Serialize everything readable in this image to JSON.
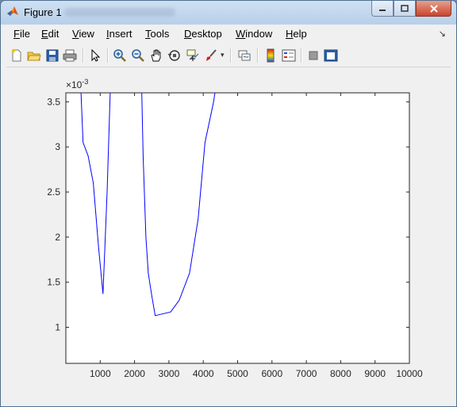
{
  "window": {
    "title": "Figure 1",
    "controls": {
      "minimize": "minimize-icon",
      "maximize": "maximize-icon",
      "close": "close-icon"
    }
  },
  "menubar": {
    "items": [
      {
        "label": "File",
        "mnemonic": "F",
        "rest": "ile"
      },
      {
        "label": "Edit",
        "mnemonic": "E",
        "rest": "dit"
      },
      {
        "label": "View",
        "mnemonic": "V",
        "rest": "iew"
      },
      {
        "label": "Insert",
        "mnemonic": "I",
        "rest": "nsert"
      },
      {
        "label": "Tools",
        "mnemonic": "T",
        "rest": "ools"
      },
      {
        "label": "Desktop",
        "mnemonic": "D",
        "rest": "esktop"
      },
      {
        "label": "Window",
        "mnemonic": "W",
        "rest": "indow"
      },
      {
        "label": "Help",
        "mnemonic": "H",
        "rest": "elp"
      }
    ]
  },
  "toolbar": {
    "buttons": [
      "new-figure-icon",
      "open-file-icon",
      "save-icon",
      "print-icon",
      "pointer-icon",
      "zoom-in-icon",
      "zoom-out-icon",
      "pan-icon",
      "rotate-3d-icon",
      "data-cursor-icon",
      "brush-icon",
      "link-plot-icon",
      "colorbar-icon",
      "legend-icon",
      "hide-plot-tools-icon",
      "show-plot-tools-icon"
    ]
  },
  "colors": {
    "line": "#0000ff",
    "axes_bg": "#ffffff",
    "figure_bg": "#f0f0f0"
  },
  "chart_data": {
    "type": "line",
    "exponent_label": "×10",
    "exponent_power": "-3",
    "xlim": [
      0,
      10000
    ],
    "ylim": [
      0.0006,
      0.0036
    ],
    "xticks": [
      1000,
      2000,
      3000,
      4000,
      5000,
      6000,
      7000,
      8000,
      9000,
      10000
    ],
    "xtick_labels": [
      "1000",
      "2000",
      "3000",
      "4000",
      "5000",
      "6000",
      "7000",
      "8000",
      "9000",
      "10000"
    ],
    "yticks": [
      0.001,
      0.0015,
      0.002,
      0.0025,
      0.003,
      0.0035
    ],
    "ytick_labels": [
      "1",
      "1.5",
      "2",
      "2.5",
      "3",
      "3.5"
    ],
    "segments": [
      {
        "x": [
          440,
          500,
          650,
          800,
          950,
          1080,
          1200,
          1290
        ],
        "y": [
          0.0036,
          0.00305,
          0.0029,
          0.0026,
          0.0019,
          0.00137,
          0.0025,
          0.0036
        ]
      },
      {
        "x": [
          2210,
          2250,
          2330,
          2400,
          2500,
          2600,
          3050,
          3300,
          3600,
          3850,
          4050,
          4300,
          4340
        ],
        "y": [
          0.0036,
          0.0029,
          0.002,
          0.0016,
          0.00135,
          0.00113,
          0.00117,
          0.0013,
          0.0016,
          0.0022,
          0.00305,
          0.0035,
          0.0036
        ]
      }
    ]
  }
}
